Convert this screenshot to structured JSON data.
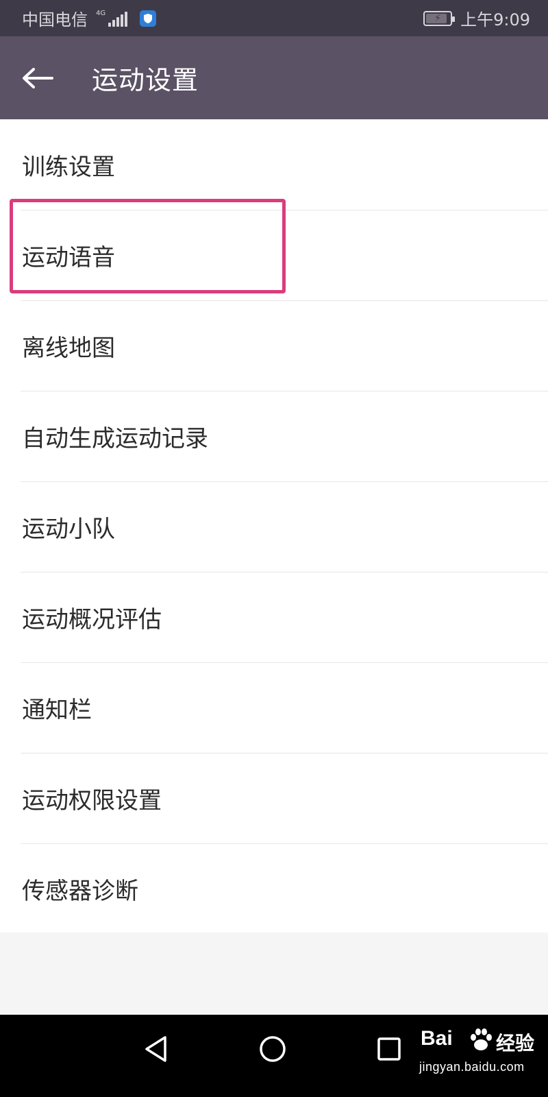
{
  "status_bar": {
    "carrier": "中国电信",
    "network": "4G",
    "time": "上午9:09"
  },
  "app_bar": {
    "title": "运动设置",
    "back_icon": "arrow-left-icon"
  },
  "menu": {
    "items": [
      {
        "label": "训练设置"
      },
      {
        "label": "运动语音"
      },
      {
        "label": "离线地图"
      },
      {
        "label": "自动生成运动记录"
      },
      {
        "label": "运动小队"
      },
      {
        "label": "运动概况评估"
      },
      {
        "label": "通知栏"
      },
      {
        "label": "运动权限设置"
      },
      {
        "label": "传感器诊断"
      }
    ],
    "highlighted_item": "运动语音"
  },
  "nav_bar": {
    "buttons": [
      "back-triangle-icon",
      "home-circle-icon",
      "recents-square-icon"
    ]
  },
  "watermark": {
    "brand": "Bai",
    "brand_cn": "经验",
    "url": "jingyan.baidu.com"
  },
  "colors": {
    "status_bar": "#3f3a47",
    "app_bar": "#5b5265",
    "highlight": "#d93d7c"
  }
}
